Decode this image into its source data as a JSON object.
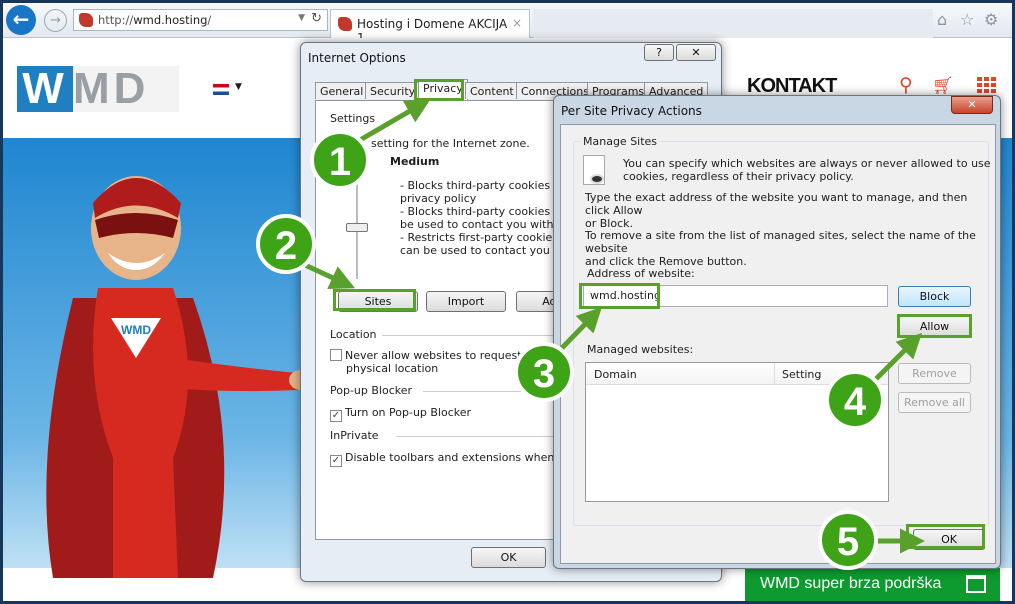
{
  "browser": {
    "url_prefix": "http://",
    "url_host": "wmd.hosting",
    "url_suffix": "/",
    "tab_title": "Hosting i Domene AKCIJA 1...",
    "tab_close": "×",
    "icons": [
      "back-arrow-icon",
      "forward-arrow-icon",
      "dropdown-icon",
      "refresh-icon",
      "home-icon",
      "star-icon",
      "gear-icon"
    ]
  },
  "site": {
    "logo_w": "W",
    "logo_md": "MD",
    "nav_kontakt": "KONTAKT",
    "mascot_badge": "WMD",
    "chat_label": "WMD super brza podrška",
    "accent": "#1f7fc0",
    "icon_color": "#e0472a",
    "chat_color": "#0d9a2f"
  },
  "internet_options": {
    "title": "Internet Options",
    "help": "?",
    "close": "✕",
    "tabs": [
      "General",
      "Security",
      "Privacy",
      "Content",
      "Connections",
      "Programs",
      "Advanced"
    ],
    "active_tab": "Privacy",
    "settings_label": "Settings",
    "zone_text": "setting for the Internet zone.",
    "level": "Medium",
    "desc": [
      "- Blocks third-party cookies that",
      "privacy policy",
      "- Blocks third-party cookies that",
      "be used to contact you without y",
      "- Restricts first-party cookies tha",
      "can be used to contact you with"
    ],
    "buttons": {
      "sites": "Sites",
      "import": "Import",
      "advanced": "Adva"
    },
    "location_label": "Location",
    "location_cb": [
      "Never allow websites to request you",
      "physical location"
    ],
    "location_checked": false,
    "popup_label": "Pop-up Blocker",
    "popup_cb": "Turn on Pop-up Blocker",
    "popup_checked": true,
    "inprivate_label": "InPrivate",
    "inprivate_cb": "Disable toolbars and extensions when InPriv",
    "inprivate_checked": true,
    "ok": "OK"
  },
  "per_site": {
    "title": "Per Site Privacy Actions",
    "close": "✕",
    "group": "Manage Sites",
    "intro": [
      "You can specify which websites are always or never allowed to use",
      "cookies, regardless of their privacy policy."
    ],
    "instr1": [
      "Type the exact address of the website you want to manage, and then click Allow",
      "or Block."
    ],
    "instr2": [
      "To remove a site from the list of managed sites, select the name of the website",
      "and click the Remove button."
    ],
    "address_label": "Address of website:",
    "address_value": "wmd.hosting",
    "block": "Block",
    "allow": "Allow",
    "managed_label": "Managed websites:",
    "col_domain": "Domain",
    "col_setting": "Setting",
    "remove": "Remove",
    "remove_all": "Remove all",
    "ok": "OK"
  },
  "steps": [
    "1",
    "2",
    "3",
    "4",
    "5"
  ],
  "step_color": "#3fa318"
}
